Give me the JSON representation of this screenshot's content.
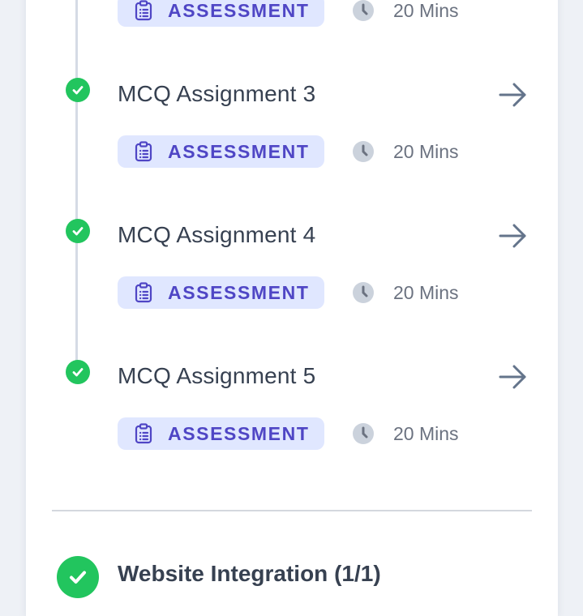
{
  "colors": {
    "accent": "#4f46c5",
    "badge_bg": "#e0e7ff",
    "success": "#22c55e",
    "text_primary": "#374151",
    "text_muted": "#6b7280"
  },
  "lessons": [
    {
      "title": "",
      "badge": "ASSESSMENT",
      "duration": "20 Mins",
      "status_icon": "check-circle-icon"
    },
    {
      "title": "MCQ Assignment 3",
      "badge": "ASSESSMENT",
      "duration": "20 Mins",
      "status_icon": "check-circle-icon"
    },
    {
      "title": "MCQ Assignment 4",
      "badge": "ASSESSMENT",
      "duration": "20 Mins",
      "status_icon": "check-circle-icon"
    },
    {
      "title": "MCQ Assignment 5",
      "badge": "ASSESSMENT",
      "duration": "20 Mins",
      "status_icon": "check-circle-icon"
    }
  ],
  "icons": {
    "badge": "clipboard-list-icon",
    "duration": "clock-icon",
    "open": "arrow-right-icon"
  },
  "next_section": {
    "title": "Website Integration (1/1)",
    "status_icon": "check-circle-icon"
  }
}
